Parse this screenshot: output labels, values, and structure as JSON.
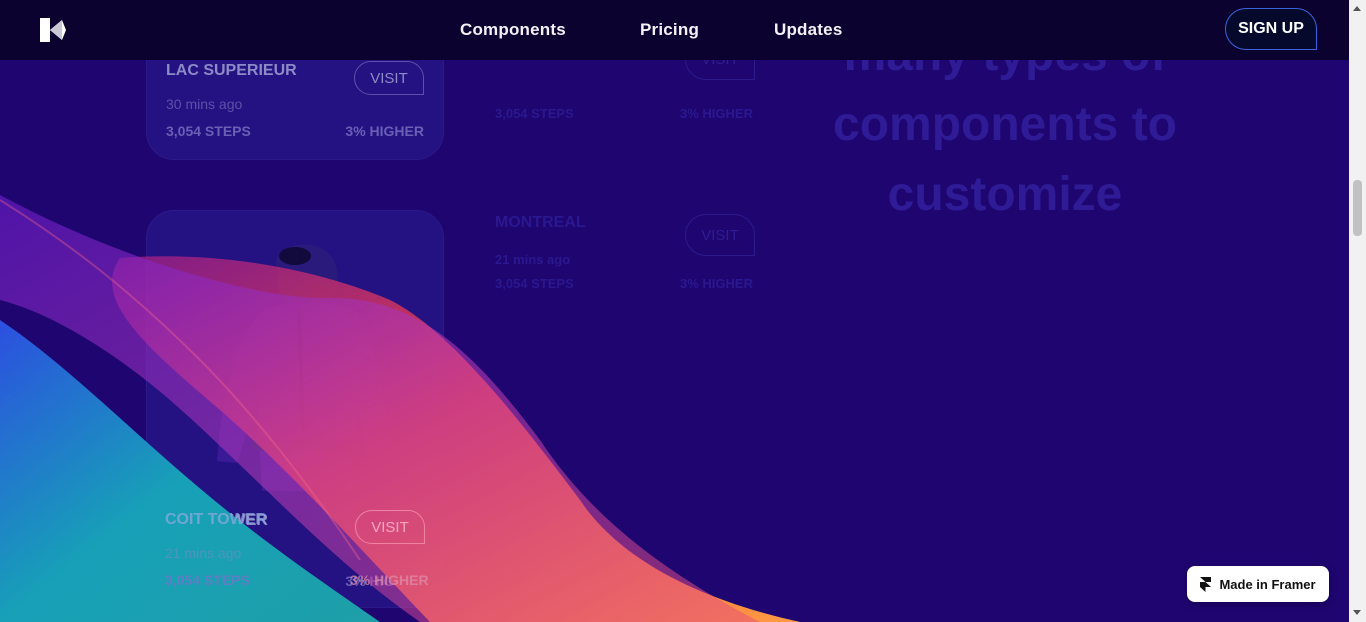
{
  "nav": {
    "links": [
      "Components",
      "Pricing",
      "Updates"
    ],
    "signup": "SIGN UP"
  },
  "cards": [
    {
      "title": "LAC SUPERIEUR",
      "time": "30 mins ago",
      "steps": "3,054 STEPS",
      "delta": "3% HIGHER",
      "button": "VISIT"
    },
    {
      "title": "COIT TOWER",
      "time": "21 mins ago",
      "steps": "3,054 STEPS",
      "delta": "3% HIGHER",
      "button": "VISIT"
    }
  ],
  "ghost_cards": [
    {
      "title": "",
      "time": "",
      "steps": "3,054 STEPS",
      "delta": "3% HIGHER",
      "button": "VISIT"
    },
    {
      "title": "MONTREAL",
      "time": "21 mins ago",
      "steps": "3,054 STEPS",
      "delta": "3% HIGHER",
      "button": "VISIT"
    }
  ],
  "heading": {
    "lines": [
      "many types of",
      "components to",
      "customize"
    ]
  },
  "badge": {
    "label": "Made in Framer"
  },
  "colors": {
    "background": "#1e0570",
    "nav": "#0b0230",
    "wave_orange": "#f25b3c",
    "wave_purple": "#8a1fc8",
    "wave_teal": "#1b8fb6"
  }
}
